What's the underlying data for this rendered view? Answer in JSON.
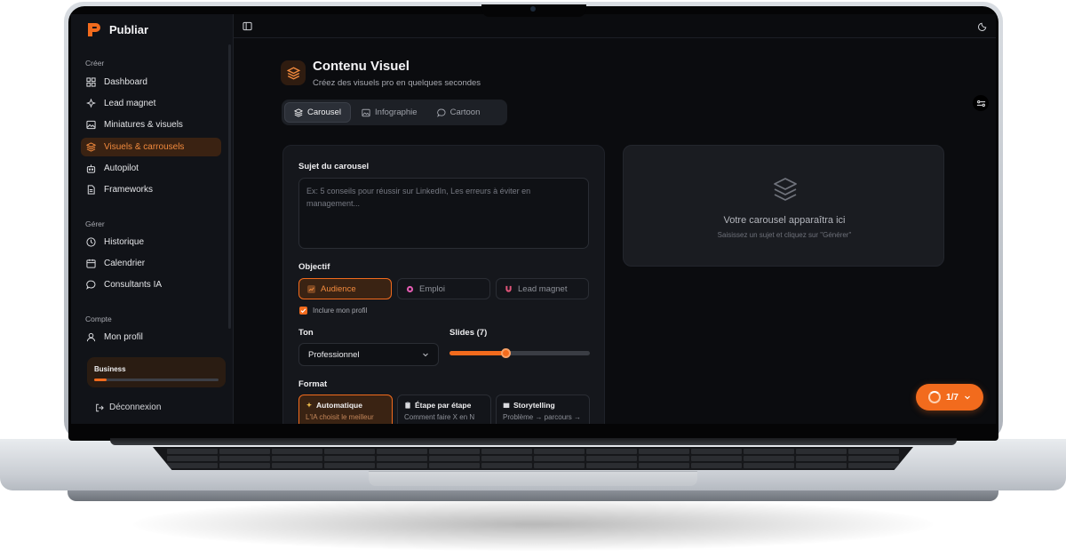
{
  "brand": {
    "name": "Publiar",
    "accent": "#f26b1d"
  },
  "sidebar": {
    "sections": [
      {
        "label": "Créer"
      },
      {
        "label": "Gérer"
      },
      {
        "label": "Compte"
      }
    ],
    "items": [
      {
        "label": "Dashboard",
        "icon": "dashboard-icon"
      },
      {
        "label": "Lead magnet",
        "icon": "sparkle-icon"
      },
      {
        "label": "Miniatures & visuels",
        "icon": "image-icon"
      },
      {
        "label": "Visuels & carrousels",
        "icon": "layers-icon",
        "active": true
      },
      {
        "label": "Autopilot",
        "icon": "bot-icon"
      },
      {
        "label": "Frameworks",
        "icon": "document-icon"
      },
      {
        "label": "Historique",
        "icon": "clock-icon"
      },
      {
        "label": "Calendrier",
        "icon": "calendar-icon"
      },
      {
        "label": "Consultants IA",
        "icon": "chat-icon"
      },
      {
        "label": "Mon profil",
        "icon": "user-icon"
      }
    ],
    "plan": {
      "label": "Business",
      "usage_fraction": 0.1
    },
    "logout_label": "Déconnexion"
  },
  "page": {
    "title": "Contenu Visuel",
    "subtitle": "Créez des visuels pro en quelques secondes"
  },
  "tabs": [
    {
      "label": "Carousel",
      "icon": "layers-icon",
      "active": true
    },
    {
      "label": "Infographie",
      "icon": "image-icon"
    },
    {
      "label": "Cartoon",
      "icon": "chat-icon"
    }
  ],
  "form": {
    "subject_label": "Sujet du carousel",
    "subject_placeholder": "Ex: 5 conseils pour réussir sur LinkedIn, Les erreurs à éviter en management...",
    "objective_label": "Objectif",
    "objectives": [
      {
        "label": "Audience",
        "active": true,
        "color": "#f28a3d"
      },
      {
        "label": "Emploi",
        "color": "#e05bb0"
      },
      {
        "label": "Lead magnet",
        "color": "#e3557a"
      }
    ],
    "include_profile_label": "Inclure mon profil",
    "include_profile_checked": true,
    "tone_label": "Ton",
    "tone_value": "Professionnel",
    "slides_label": "Slides (7)",
    "slides_fraction": 0.4,
    "format_label": "Format",
    "formats": [
      {
        "title": "Automatique",
        "desc": "L'IA choisit le meilleur format",
        "icon": "sparkle-icon",
        "active": true
      },
      {
        "title": "Étape par étape",
        "desc": "Comment faire X en N étapes",
        "icon": "document-icon"
      },
      {
        "title": "Storytelling",
        "desc": "Problème → parcours → résultat",
        "icon": "book-icon"
      }
    ]
  },
  "preview": {
    "title": "Votre carousel apparaîtra ici",
    "subtitle": "Saisissez un sujet et cliquez sur \"Générer\""
  },
  "progress": {
    "label": "1/7"
  }
}
